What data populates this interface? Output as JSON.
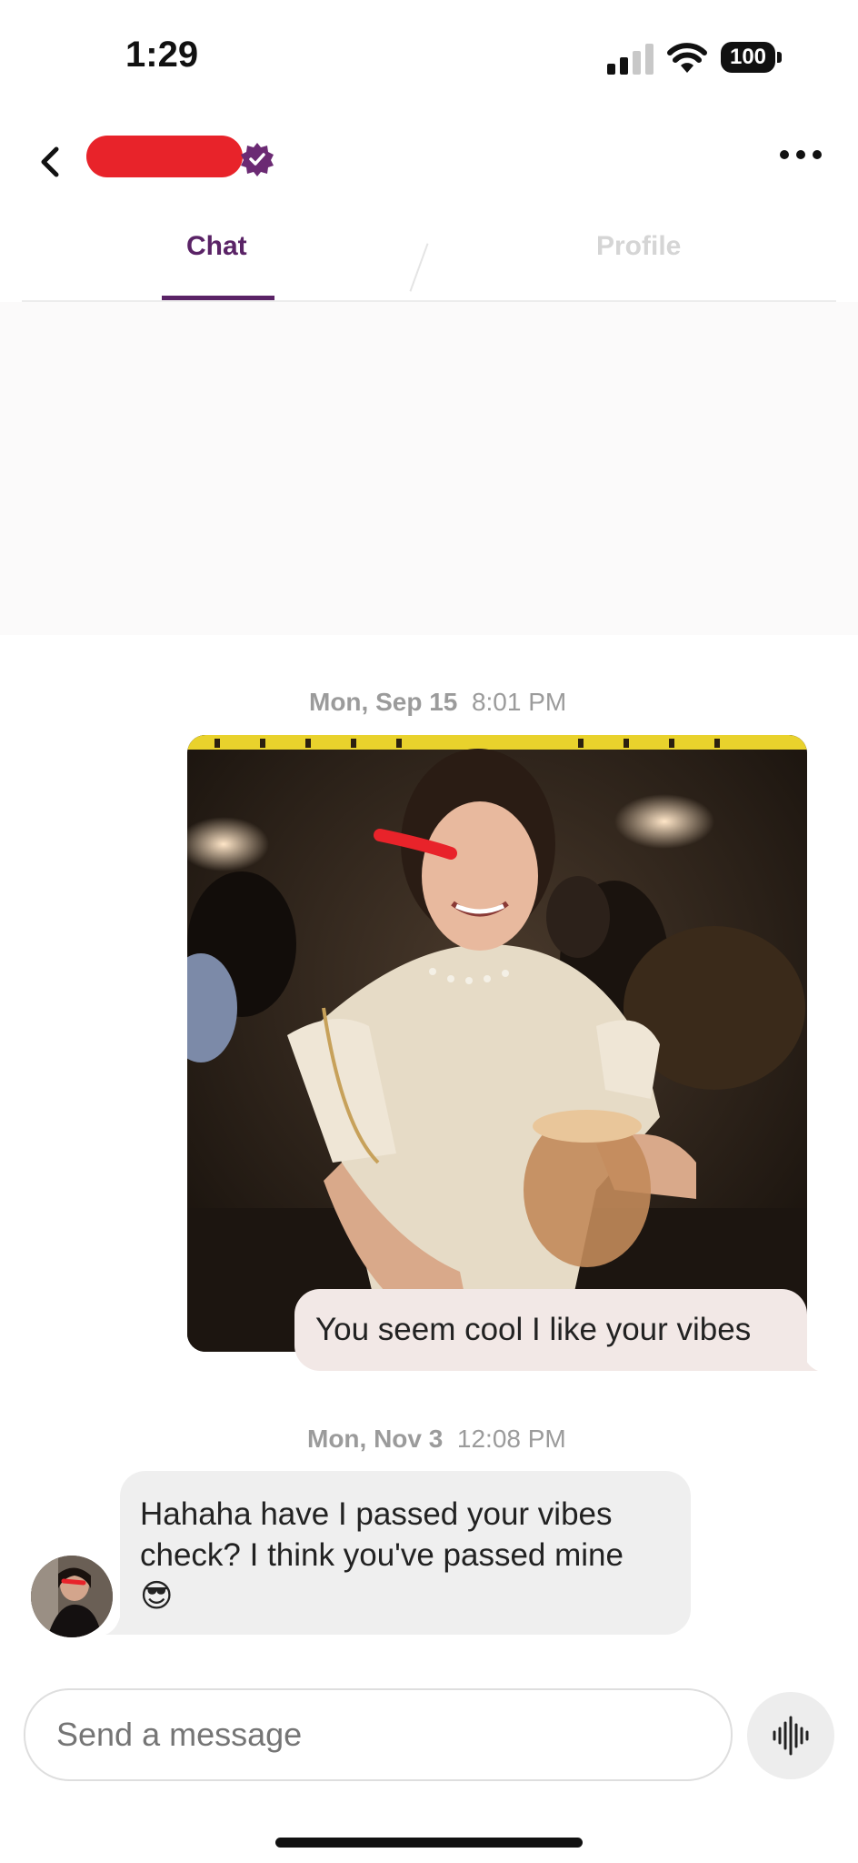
{
  "status_bar": {
    "time": "1:29",
    "battery": "100"
  },
  "header": {
    "back_icon": "chevron-left-icon",
    "verified_icon": "verified-badge-icon",
    "verified_color": "#6b2a73",
    "more_icon": "ellipsis-icon"
  },
  "tabs": [
    {
      "label": "Chat",
      "active": true
    },
    {
      "label": "Profile",
      "active": false
    }
  ],
  "accent_color": "#5a2366",
  "messages": [
    {
      "date": "Mon, Sep 15",
      "time": "8:01 PM",
      "direction": "outgoing",
      "has_photo": true,
      "text": "You seem cool I like your vibes"
    },
    {
      "date": "Mon, Nov 3",
      "time": "12:08 PM",
      "direction": "incoming",
      "text": "Hahaha have I passed your vibes check? I think you've passed mine",
      "emoji": "😎"
    }
  ],
  "composer": {
    "placeholder": "Send a message",
    "voice_icon": "waveform-icon"
  }
}
